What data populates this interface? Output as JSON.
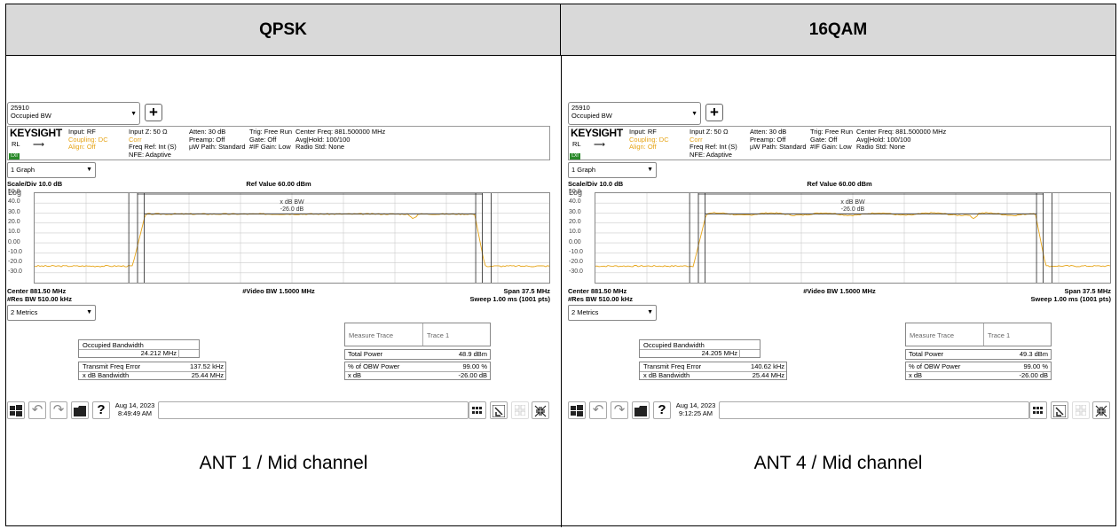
{
  "headers": [
    "QPSK",
    "16QAM"
  ],
  "captions": [
    "ANT 1 / Mid channel",
    "ANT 4 / Mid channel"
  ],
  "common": {
    "mode_num": "25910",
    "mode_name": "Occupied BW",
    "plus": "+",
    "brand": "KEYSIGHT",
    "rl": "RL",
    "lxi": "LXI",
    "input_rf": "Input: RF",
    "coupling": "Coupling: DC",
    "align": "Align: Off",
    "input_z": "Input Z: 50 Ω",
    "corr": "Corr",
    "freq_ref": "Freq Ref: Int (S)",
    "nfe": "NFE: Adaptive",
    "atten": "Atten: 30 dB",
    "preamp": "Preamp: Off",
    "uw_path": "µW Path: Standard",
    "trig": "Trig: Free Run",
    "gate": "Gate: Off",
    "if_gain": "#IF Gain: Low",
    "center_freq": "Center Freq: 881.500000 MHz",
    "avg_hold": "Avg|Hold: 100/100",
    "radio_std": "Radio Std: None",
    "graph_sel": "1 Graph",
    "scale_div": "Scale/Div 10.0 dB",
    "ref_value": "Ref Value 60.00 dBm",
    "log": "Log",
    "y_ticks": [
      "50.0",
      "40.0",
      "30.0",
      "20.0",
      "10.0",
      "0.00",
      "-10.0",
      "-20.0",
      "-30.0"
    ],
    "xdb_bw": "x dB BW",
    "xdb_val": "-26.0 dB",
    "center": "Center 881.50 MHz",
    "res_bw": "#Res BW 510.00 kHz",
    "video_bw": "#Video BW 1.5000 MHz",
    "span": "Span 37.5 MHz",
    "sweep": "Sweep 1.00 ms (1001 pts)",
    "metrics_sel": "2 Metrics",
    "measure_trace": "Measure Trace",
    "trace1": "Trace 1",
    "occ_bw_label": "Occupied Bandwidth",
    "tfe_label": "Transmit Freq Error",
    "xdb_bw_label": "x dB Bandwidth",
    "total_power_label": "Total Power",
    "obw_power_label": "% of OBW Power",
    "xdb_label": "x dB",
    "obw_power": "99.00 %",
    "xdb_value": "-26.00 dB",
    "date": "Aug 14, 2023"
  },
  "panels": [
    {
      "occ_bw": "24.212 MHz",
      "tfe": "137.52 kHz",
      "xdb_bw_val": "25.44 MHz",
      "total_power": "48.9 dBm",
      "time": "8:49:49 AM"
    },
    {
      "occ_bw": "24.205 MHz",
      "tfe": "140.62 kHz",
      "xdb_bw_val": "25.44 MHz",
      "total_power": "49.3 dBm",
      "time": "9:12:25 AM"
    }
  ],
  "colors": {
    "trace": "#e6a417",
    "header_bg": "#d9d9d9",
    "lxi": "#2a8a2a"
  }
}
